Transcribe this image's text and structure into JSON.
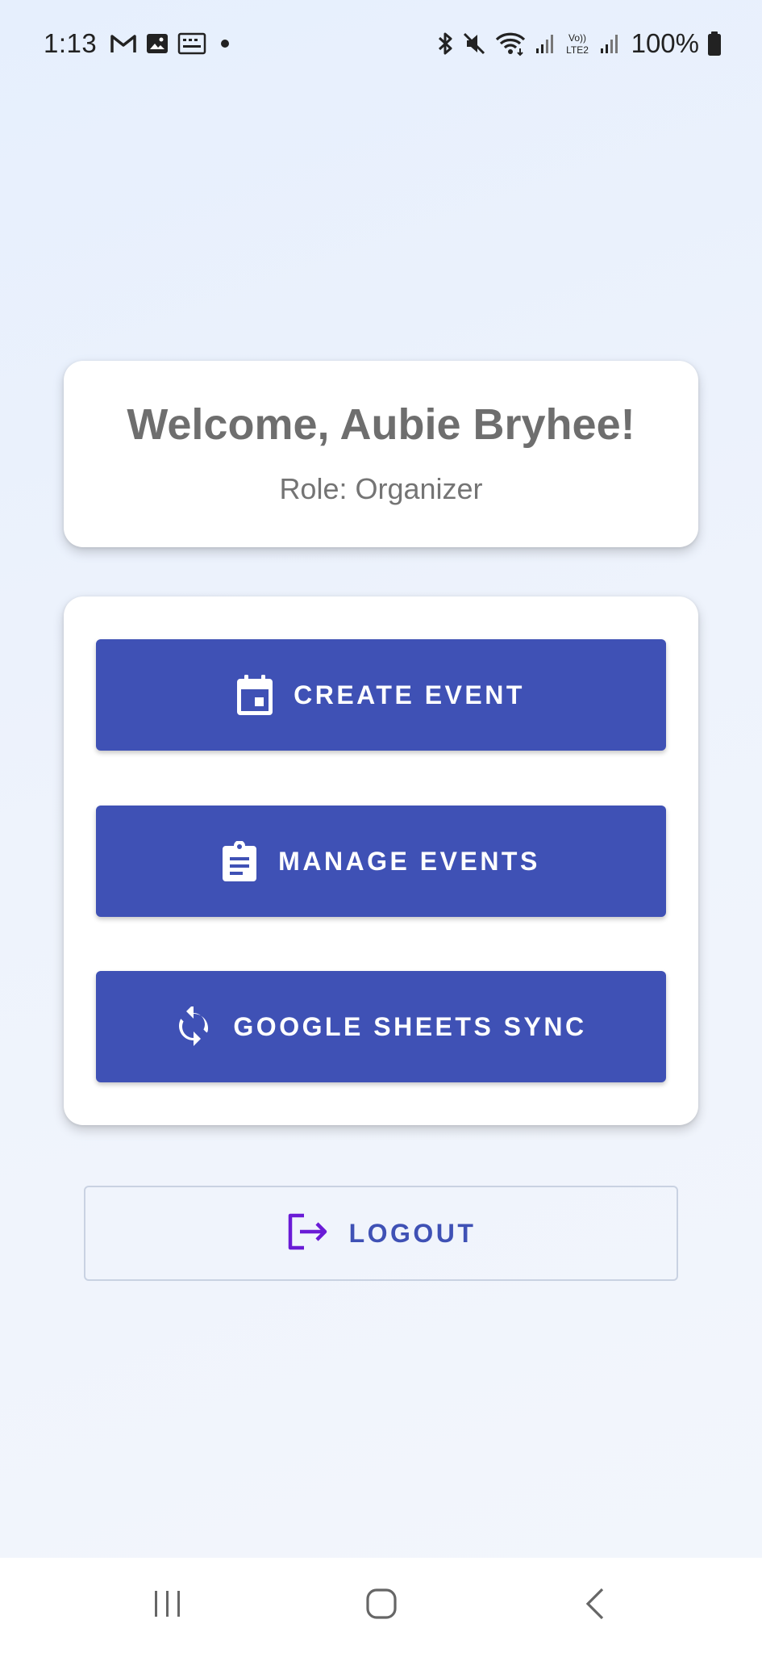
{
  "status_bar": {
    "time": "1:13",
    "battery": "100%",
    "icons": [
      "gmail-icon",
      "gallery-icon",
      "screenshot-icon",
      "notification-dot",
      "bluetooth-icon",
      "mute-icon",
      "wifi-icon",
      "signal-icon",
      "volte-icon",
      "signal-icon",
      "battery-icon"
    ]
  },
  "welcome": {
    "title": "Welcome, Aubie Bryhee!",
    "role": "Role: Organizer"
  },
  "actions": {
    "create_event": {
      "label": "CREATE EVENT",
      "icon": "calendar-icon"
    },
    "manage_events": {
      "label": "MANAGE EVENTS",
      "icon": "clipboard-icon"
    },
    "sheets_sync": {
      "label": "GOOGLE SHEETS SYNC",
      "icon": "sync-icon"
    }
  },
  "logout": {
    "label": "LOGOUT",
    "icon": "logout-icon"
  },
  "colors": {
    "primary": "#3f51b5",
    "logout_icon": "#6a1bd6",
    "card": "#ffffff",
    "background": "#e9f0fb"
  },
  "nav_bar": {
    "buttons": [
      "recents-icon",
      "home-icon",
      "back-icon"
    ]
  }
}
